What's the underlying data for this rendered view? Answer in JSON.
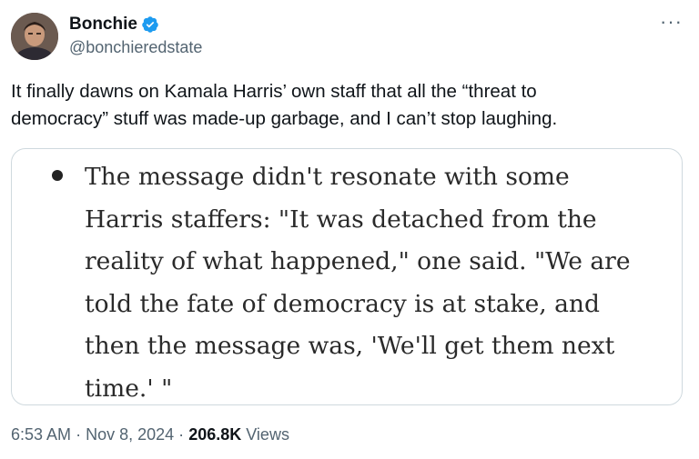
{
  "author": {
    "display_name": "Bonchie",
    "handle": "@bonchieredstate",
    "verified": true
  },
  "icons": {
    "verified": "verified-badge-icon",
    "more": "more-options-icon"
  },
  "colors": {
    "verified_badge": "#1d9bf0",
    "secondary_text": "#536471",
    "card_border": "#cfd9de"
  },
  "more_label": "···",
  "tweet_text": "It finally dawns on Kamala Harris’ own staff that all the “threat to\ndemocracy” stuff was made-up garbage, and I can’t stop laughing.",
  "quote": {
    "lines": [
      "The message didn't resonate with some",
      "Harris staffers: \"It was detached from the",
      "reality of what happened,\" one said. \"We are",
      "told the fate of democracy is at stake, and",
      "then the message was, 'We'll get them next",
      "time.' \""
    ]
  },
  "meta": {
    "time": "6:53 AM",
    "separator": "·",
    "date": "Nov 8, 2024",
    "views_count": "206.8K",
    "views_label": "Views"
  }
}
